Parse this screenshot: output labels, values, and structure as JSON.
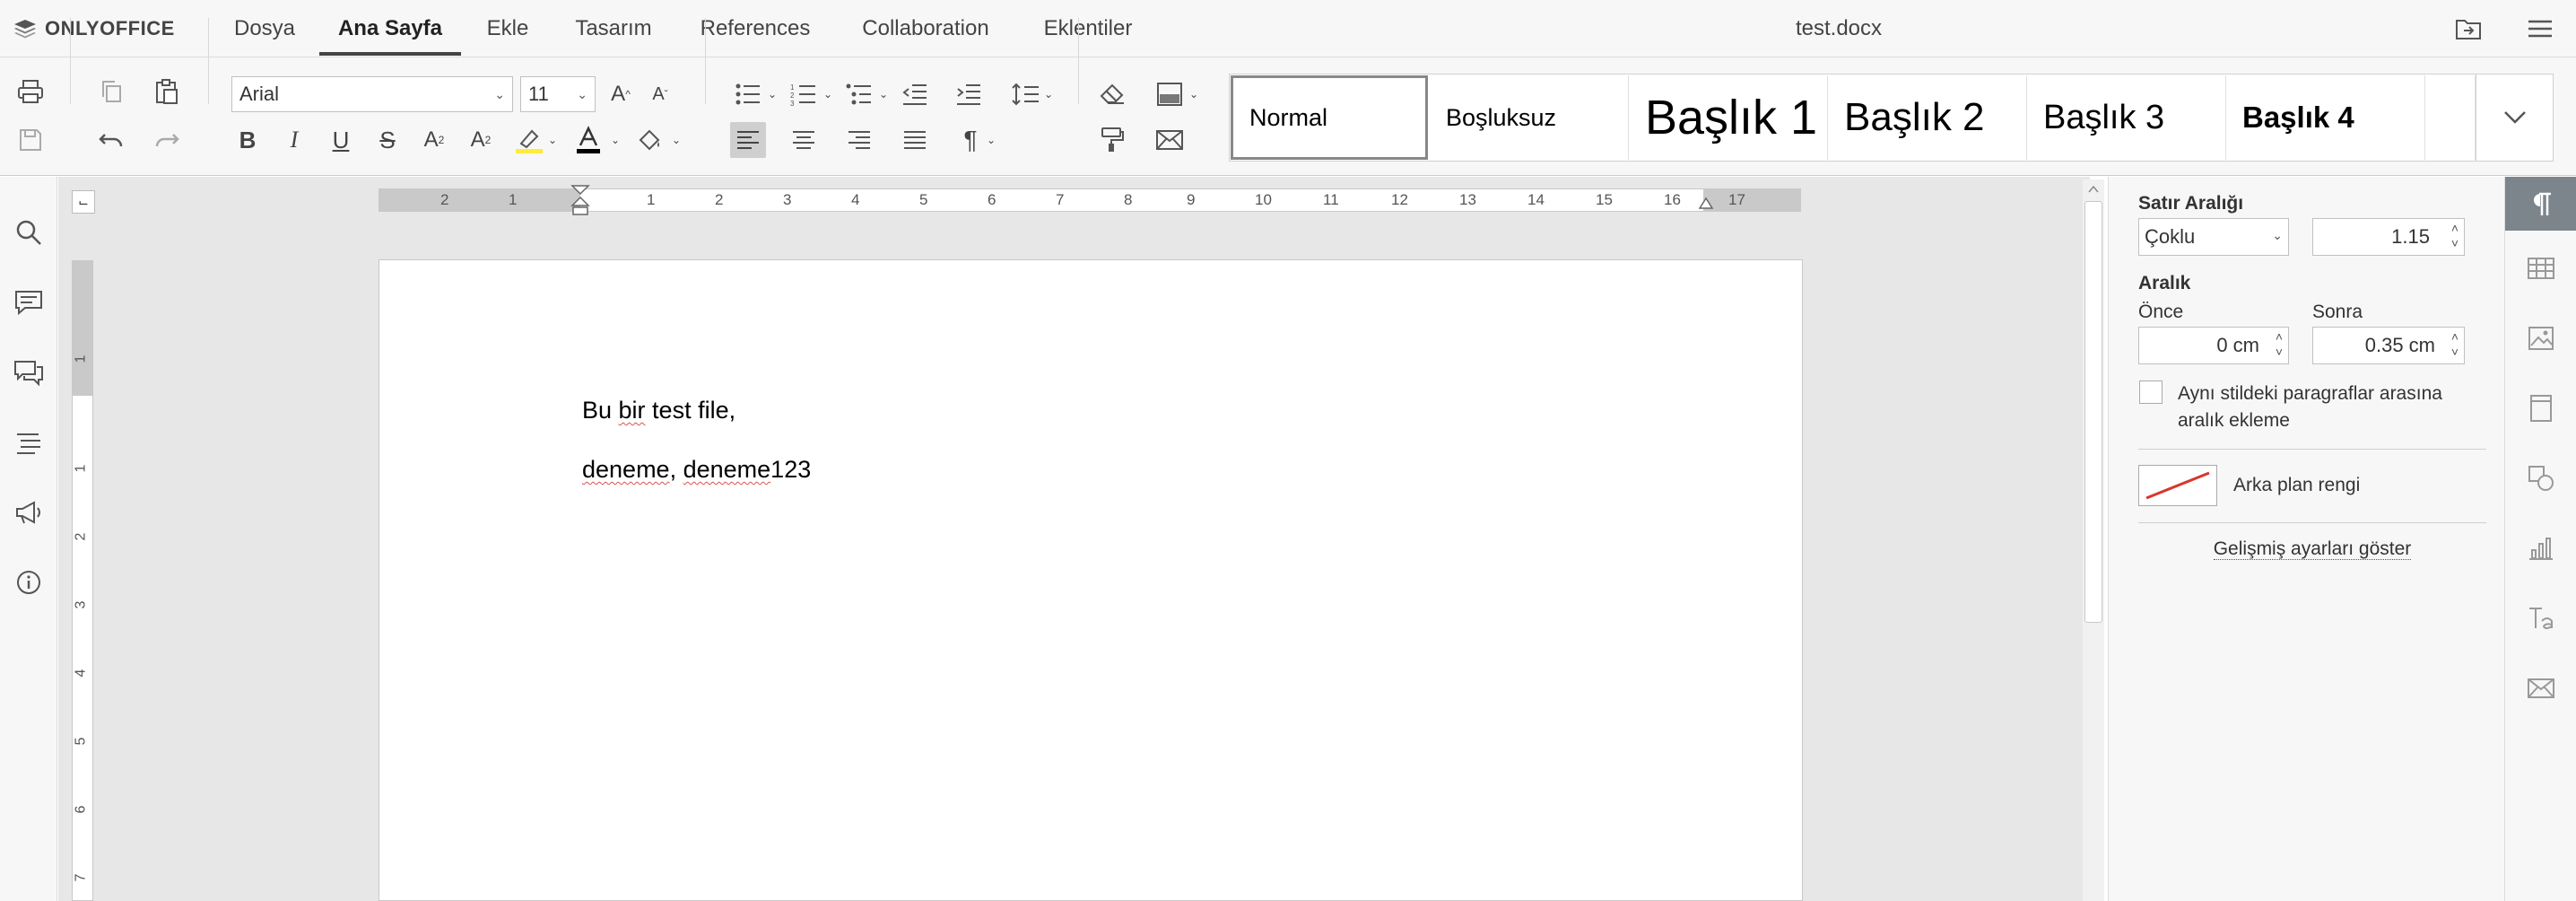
{
  "app": {
    "logo_text": "ONLYOFFICE",
    "doc_title": "test.docx"
  },
  "menu": {
    "tabs": [
      {
        "label": "Dosya"
      },
      {
        "label": "Ana Sayfa",
        "active": true
      },
      {
        "label": "Ekle"
      },
      {
        "label": "Tasarım"
      },
      {
        "label": "References"
      },
      {
        "label": "Collaboration"
      },
      {
        "label": "Eklentiler"
      }
    ]
  },
  "toolbar": {
    "font_name": "Arial",
    "font_size": "11",
    "styles": [
      {
        "label": "Normal"
      },
      {
        "label": "Boşluksuz"
      },
      {
        "label": "Başlık 1"
      },
      {
        "label": "Başlık 2"
      },
      {
        "label": "Başlık 3"
      },
      {
        "label": "Başlık 4"
      }
    ]
  },
  "ruler": {
    "h_labels": [
      "2",
      "1",
      "1",
      "2",
      "3",
      "4",
      "5",
      "6",
      "7",
      "8",
      "9",
      "10",
      "11",
      "12",
      "13",
      "14",
      "15",
      "16",
      "17"
    ],
    "v_labels": [
      "1",
      "1",
      "2",
      "3",
      "4",
      "5",
      "6",
      "7"
    ]
  },
  "document": {
    "paragraphs": [
      {
        "prefix": "Bu ",
        "misspelled": "bir",
        "suffix": " test file,"
      },
      {
        "w1": "deneme",
        "mid": ", ",
        "w2": "deneme",
        "tail": "123"
      }
    ]
  },
  "paragraph_settings": {
    "line_spacing_label": "Satır Aralığı",
    "line_spacing_mode": "Çoklu",
    "line_spacing_value": "1.15",
    "spacing_label": "Aralık",
    "before_label": "Önce",
    "before_value": "0 cm",
    "after_label": "Sonra",
    "after_value": "0.35 cm",
    "same_style_checkbox_label_line1": "Aynı stildeki paragraflar arasına",
    "same_style_checkbox_label_line2": "aralık ekleme",
    "background_color_label": "Arka plan rengi",
    "advanced_link": "Gelişmiş ayarları göster"
  },
  "colors": {
    "accent": "#444444",
    "misspell_underline": "#d9534f",
    "right_panel_active": "#7d858c",
    "highlight_color": "#ffeb3b",
    "font_color": "#000000"
  }
}
